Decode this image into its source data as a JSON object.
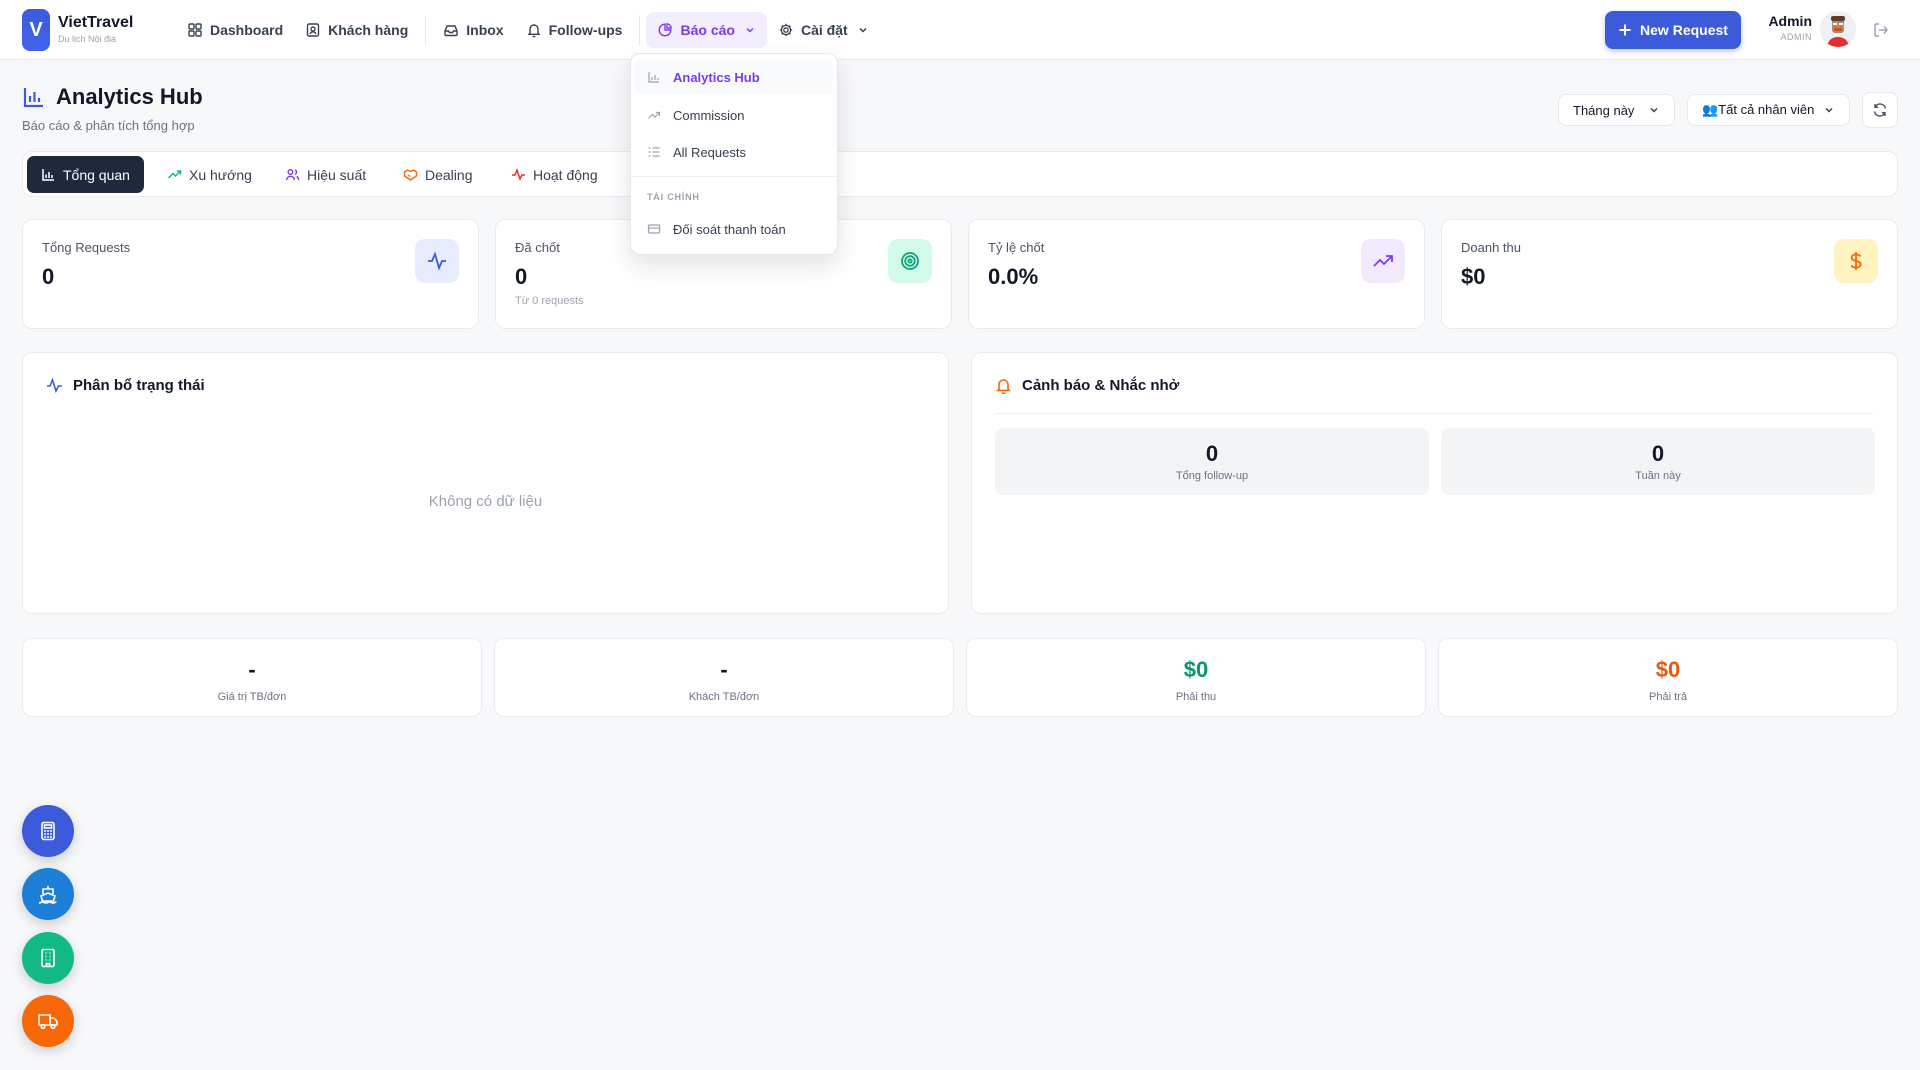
{
  "brand": {
    "logo_letter": "V",
    "name": "VietTravel",
    "subtitle": "Du lịch Nội địa"
  },
  "nav": {
    "dashboard": "Dashboard",
    "customers": "Khách hàng",
    "inbox": "Inbox",
    "followups": "Follow-ups",
    "reports": "Báo cáo",
    "settings": "Cài đặt"
  },
  "new_request_label": "New Request",
  "user": {
    "name": "Admin",
    "role": "ADMIN"
  },
  "page": {
    "title": "Analytics Hub",
    "subtitle": "Báo cáo & phân tích tổng hợp"
  },
  "filters": {
    "period": "Tháng này",
    "staff": "👥Tất cả nhân viên"
  },
  "tabs": [
    {
      "label": "Tổng quan"
    },
    {
      "label": "Xu hướng"
    },
    {
      "label": "Hiệu suất"
    },
    {
      "label": "Dealing"
    },
    {
      "label": "Hoạt động"
    }
  ],
  "stats": [
    {
      "label": "Tổng Requests",
      "value": "0",
      "note": ""
    },
    {
      "label": "Đã chốt",
      "value": "0",
      "note": "Từ 0 requests"
    },
    {
      "label": "Tỷ lệ chốt",
      "value": "0.0%",
      "note": ""
    },
    {
      "label": "Doanh thu",
      "value": "$0",
      "note": ""
    }
  ],
  "status_panel": {
    "title": "Phân bổ trạng thái",
    "empty_text": "Không có dữ liệu"
  },
  "alerts_panel": {
    "title": "Cảnh báo & Nhắc nhở",
    "items": [
      {
        "value": "0",
        "label": "Tổng follow-up"
      },
      {
        "value": "0",
        "label": "Tuần này"
      }
    ]
  },
  "bottom_stats": [
    {
      "value": "-",
      "label": "Giá trị TB/đơn",
      "color": "#111827"
    },
    {
      "value": "-",
      "label": "Khách TB/đơn",
      "color": "#111827"
    },
    {
      "value": "$0",
      "label": "Phải thu",
      "color": "#059669"
    },
    {
      "value": "$0",
      "label": "Phải trả",
      "color": "#ea580c"
    }
  ],
  "dropdown": {
    "items": [
      "Analytics Hub",
      "Commission",
      "All Requests"
    ],
    "section_title": "TÀI CHÍNH",
    "finance_items": [
      "Đối soát thanh toán"
    ]
  },
  "colors": {
    "primary": "#3b5bdb",
    "accent_purple": "#7c3aed",
    "fab_blue": "#3b5bdb",
    "fab_sky": "#1c7ed6",
    "fab_green": "#12b886",
    "fab_orange": "#f76707"
  }
}
